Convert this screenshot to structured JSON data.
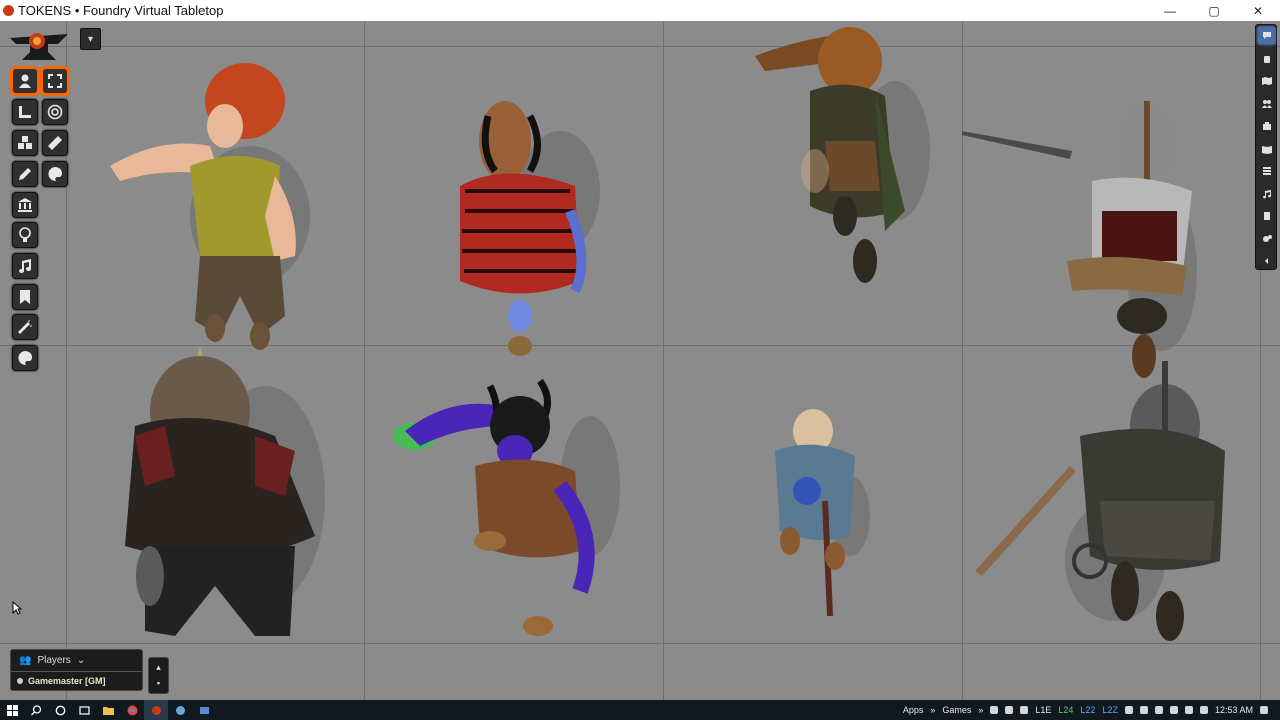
{
  "window": {
    "title": "TOKENS • Foundry Virtual Tabletop",
    "minimize_label": "—",
    "maximize_label": "▢",
    "close_label": "✕"
  },
  "scene": {
    "toggle_label": "▾",
    "grid": {
      "columns": 4,
      "rows": 2
    },
    "tokens": [
      {
        "name": "red-haired-woman-token"
      },
      {
        "name": "blue-tiefling-woman-token"
      },
      {
        "name": "hooded-ranger-token"
      },
      {
        "name": "helmeted-swordsman-token"
      },
      {
        "name": "armored-warrior-token"
      },
      {
        "name": "purple-tiefling-caster-token"
      },
      {
        "name": "old-wizard-token"
      },
      {
        "name": "halberd-guard-token"
      }
    ]
  },
  "controls": {
    "left": [
      {
        "name": "token-controls-button",
        "icon": "user-icon",
        "active": true
      },
      {
        "name": "measure-controls-button",
        "icon": "ruler-icon",
        "active": false
      },
      {
        "name": "tile-controls-button",
        "icon": "cubes-icon",
        "active": false
      },
      {
        "name": "drawing-controls-button",
        "icon": "pencil-icon",
        "active": false
      },
      {
        "name": "wall-controls-button",
        "icon": "building-columns-icon",
        "active": false
      },
      {
        "name": "lighting-controls-button",
        "icon": "lightbulb-icon",
        "active": false
      },
      {
        "name": "sound-controls-button",
        "icon": "music-icon",
        "active": false
      },
      {
        "name": "notes-controls-button",
        "icon": "bookmark-icon",
        "active": false
      },
      {
        "name": "effects-controls-button",
        "icon": "magic-wand-icon",
        "active": false
      },
      {
        "name": "palette-controls-button",
        "icon": "palette-icon",
        "active": false
      }
    ],
    "tools": [
      {
        "name": "expand-tool-button",
        "icon": "expand-icon",
        "active": true
      },
      {
        "name": "target-tool-button",
        "icon": "target-icon",
        "active": false
      },
      {
        "name": "ruler-tool-button",
        "icon": "ruler-icon",
        "active": false
      },
      {
        "name": "palette-tool-button",
        "icon": "palette-icon",
        "active": false
      }
    ]
  },
  "sidebar": {
    "tabs": [
      {
        "name": "chat-tab",
        "icon": "comments-icon",
        "active": true
      },
      {
        "name": "combat-tab",
        "icon": "fist-icon",
        "active": false
      },
      {
        "name": "scenes-tab",
        "icon": "map-icon",
        "active": false
      },
      {
        "name": "actors-tab",
        "icon": "users-icon",
        "active": false
      },
      {
        "name": "items-tab",
        "icon": "suitcase-icon",
        "active": false
      },
      {
        "name": "journal-tab",
        "icon": "book-open-icon",
        "active": false
      },
      {
        "name": "tables-tab",
        "icon": "th-list-icon",
        "active": false
      },
      {
        "name": "playlists-tab",
        "icon": "music-icon",
        "active": false
      },
      {
        "name": "compendium-tab",
        "icon": "atlas-icon",
        "active": false
      },
      {
        "name": "settings-tab",
        "icon": "cogs-icon",
        "active": false
      },
      {
        "name": "collapse-tab",
        "icon": "caret-left-icon",
        "active": false
      }
    ]
  },
  "players": {
    "header": "Players",
    "chevron": "⌄",
    "users": [
      {
        "label": "Gamemaster [GM]",
        "color": "#cfcfcf"
      }
    ]
  },
  "hotbar": {
    "up": "▴",
    "folder": "▪"
  },
  "taskbar": {
    "apps_label": "Apps",
    "games_label": "Games",
    "chevron": "»",
    "time": "12:53 AM",
    "tray_numbers": [
      "L1E",
      "L24",
      "L22",
      "L2Z"
    ]
  },
  "colors": {
    "accent": "#ff6400",
    "sidebar_active": "#4a6fa8"
  }
}
